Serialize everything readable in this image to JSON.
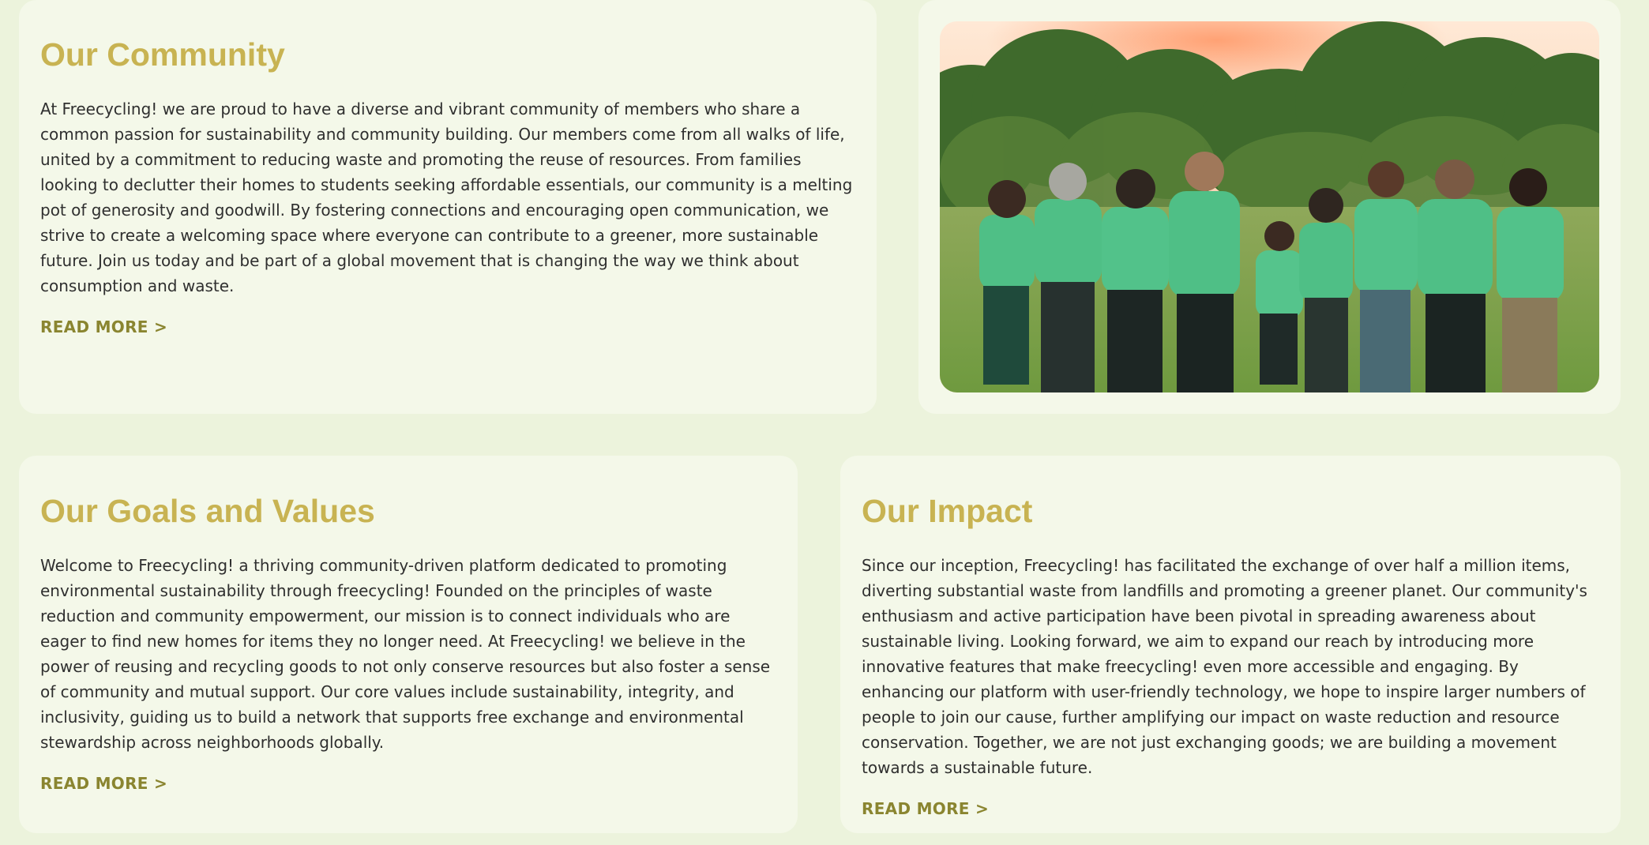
{
  "community": {
    "title": "Our Community",
    "body": "At Freecycling! we are proud to have a diverse and vibrant community of members who share a common passion for sustainability and community building. Our members come from all walks of life, united by a commitment to reducing waste and promoting the reuse of resources. From families looking to declutter their homes to students seeking affordable essentials, our community is a melting pot of generosity and goodwill. By fostering connections and encouraging open communication, we strive to create a welcoming space where everyone can contribute to a greener, more sustainable future. Join us today and be part of a global movement that is changing the way we think about consumption and waste.",
    "read_more": "READ MORE >"
  },
  "photo": {
    "subject": "community-group-photo"
  },
  "goals": {
    "title": "Our Goals and Values",
    "body": "Welcome to Freecycling! a thriving community-driven platform dedicated to promoting environmental sustainability through freecycling! Founded on the principles of waste reduction and community empowerment, our mission is to connect individuals who are eager to find new homes for items they no longer need. At Freecycling! we believe in the power of reusing and recycling goods to not only conserve resources but also foster a sense of community and mutual support. Our core values include sustainability, integrity, and inclusivity, guiding us to build a network that supports free exchange and environmental stewardship across neighborhoods globally.",
    "read_more": "READ MORE >"
  },
  "impact": {
    "title": "Our Impact",
    "body": "Since our inception, Freecycling! has facilitated the exchange of over half a million items, diverting substantial waste from landfills and promoting a greener planet. Our community's enthusiasm and active participation have been pivotal in spreading awareness about sustainable living. Looking forward, we aim to expand our reach by introducing more innovative features that make freecycling! even more accessible and engaging. By enhancing our platform with user-friendly technology, we hope to inspire larger numbers of people to join our cause, further amplifying our impact on waste reduction and resource conservation. Together, we are not just exchanging goods; we are building a movement towards a sustainable future.",
    "read_more": "READ MORE >"
  },
  "colors": {
    "page_background": "#ecf3dc",
    "card_background": "#f4f8e9",
    "heading": "#c8b352",
    "body_text": "#2f2f2f",
    "link": "#8a8530",
    "shirt_green": "#4fbf86"
  }
}
